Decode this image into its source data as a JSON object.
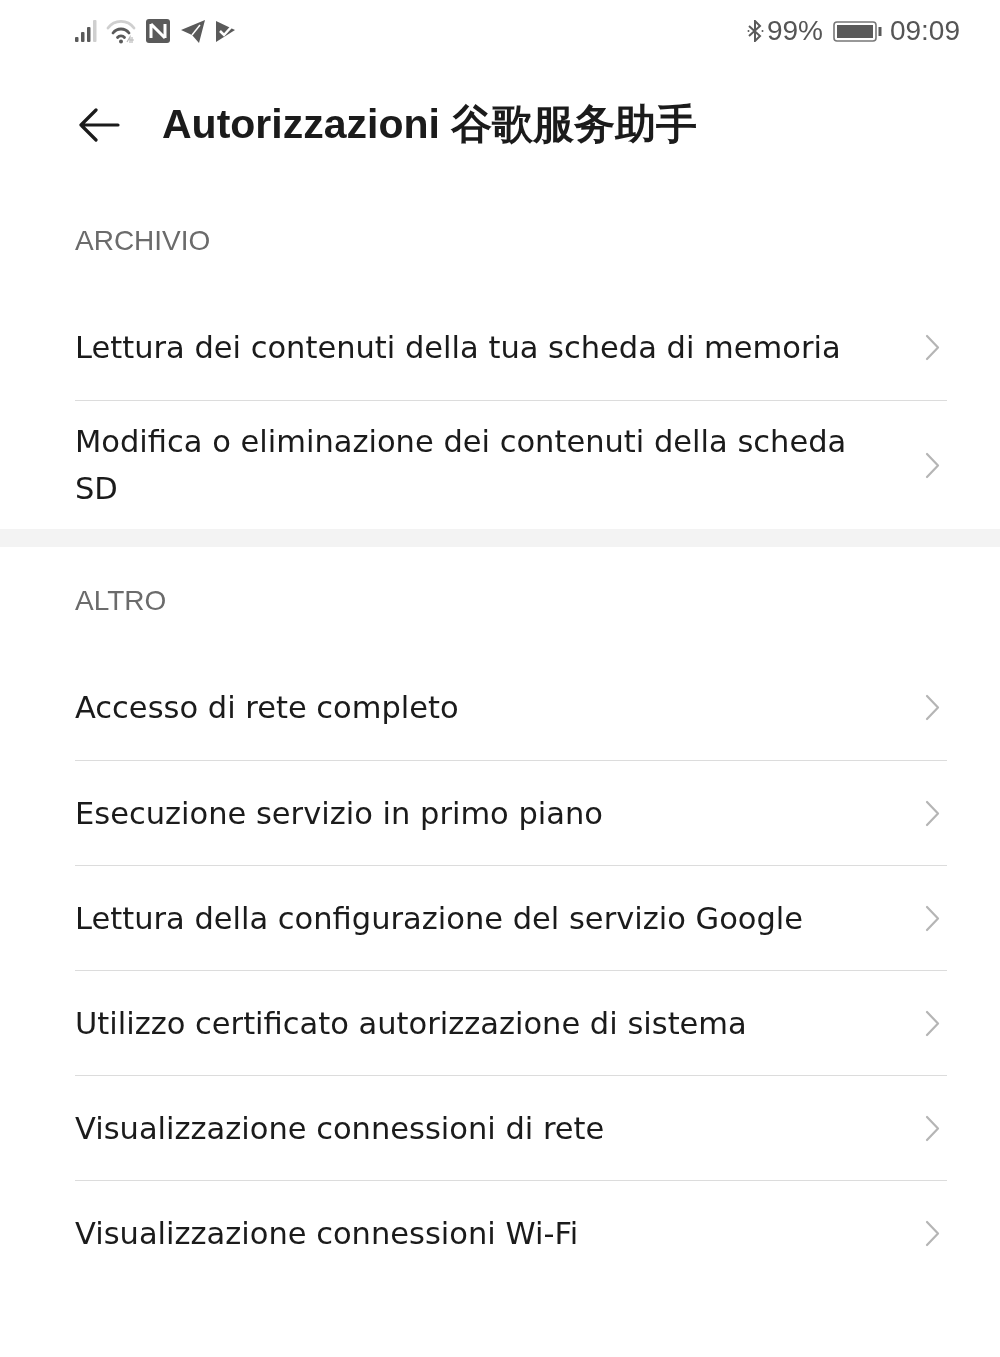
{
  "status_bar": {
    "battery_percent": "99%",
    "time": "09:09"
  },
  "header": {
    "title": "Autorizzazioni 谷歌服务助手"
  },
  "sections": [
    {
      "label": "ARCHIVIO",
      "items": [
        {
          "label": "Lettura dei contenuti della tua scheda di memoria"
        },
        {
          "label": "Modifica o eliminazione dei contenuti della scheda SD"
        }
      ]
    },
    {
      "label": "ALTRO",
      "items": [
        {
          "label": "Accesso di rete completo"
        },
        {
          "label": "Esecuzione servizio in primo piano"
        },
        {
          "label": "Lettura della configurazione del servizio Google"
        },
        {
          "label": "Utilizzo certificato autorizzazione di sistema"
        },
        {
          "label": "Visualizzazione connessioni di rete"
        },
        {
          "label": "Visualizzazione connessioni Wi-Fi"
        }
      ]
    }
  ]
}
